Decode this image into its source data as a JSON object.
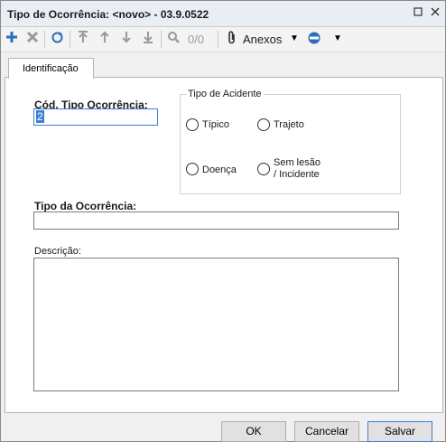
{
  "window": {
    "title": "Tipo de Ocorrência: <novo> - 03.9.0522"
  },
  "toolbar": {
    "record_count": "0/0",
    "attachments_label": "Anexos"
  },
  "tabs": [
    {
      "label": "Identificação"
    }
  ],
  "form": {
    "cod_label": "Cód. Tipo Ocorrência:",
    "cod_value": "2",
    "tipo_acidente_label": "Tipo de Acidente",
    "radios": {
      "tipico": "Típico",
      "trajeto": "Trajeto",
      "doenca": "Doença",
      "sem_lesao_line1": "Sem lesão",
      "sem_lesao_line2": "/ Incidente"
    },
    "tipo_ocorrencia_label": "Tipo da Ocorrência:",
    "tipo_ocorrencia_value": "",
    "descricao_label": "Descrição:",
    "descricao_value": ""
  },
  "buttons": {
    "ok": "OK",
    "cancel": "Cancelar",
    "save": "Salvar"
  }
}
